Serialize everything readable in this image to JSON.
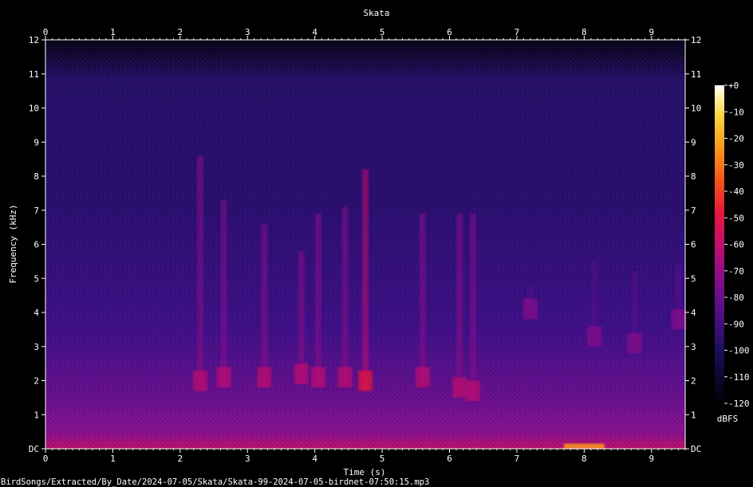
{
  "chart_data": {
    "type": "heatmap",
    "title": "Skata",
    "xlabel": "Time (s)",
    "ylabel": "Frequency (kHz)",
    "xlim": [
      0,
      9.5
    ],
    "ylim": [
      0,
      12
    ],
    "x_ticks": [
      "0",
      "1",
      "2",
      "3",
      "4",
      "5",
      "6",
      "7",
      "8",
      "9"
    ],
    "y_ticks": [
      "DC",
      "1",
      "2",
      "3",
      "4",
      "5",
      "6",
      "7",
      "8",
      "9",
      "10",
      "11",
      "12"
    ],
    "colorbar": {
      "label": "dBFS",
      "range": [
        -120,
        0
      ],
      "ticks": [
        "+0",
        "-10",
        "-20",
        "-30",
        "-40",
        "-50",
        "-60",
        "-70",
        "-80",
        "-90",
        "-100",
        "-110",
        "-120"
      ],
      "colors": [
        "#000000",
        "#0b0a3b",
        "#2a0f6b",
        "#5a0f8a",
        "#8a0f8a",
        "#c0106e",
        "#e8183a",
        "#f5541a",
        "#f8961c",
        "#fbd13a",
        "#fdf6b4",
        "#ffffff"
      ]
    },
    "calls": [
      {
        "t": 2.3,
        "f_low": 1.7,
        "f_high": 8.6,
        "level": -72
      },
      {
        "t": 2.65,
        "f_low": 1.8,
        "f_high": 7.3,
        "level": -76
      },
      {
        "t": 3.25,
        "f_low": 1.8,
        "f_high": 6.6,
        "level": -76
      },
      {
        "t": 3.8,
        "f_low": 1.9,
        "f_high": 5.8,
        "level": -78
      },
      {
        "t": 4.05,
        "f_low": 1.8,
        "f_high": 6.9,
        "level": -74
      },
      {
        "t": 4.45,
        "f_low": 1.8,
        "f_high": 7.1,
        "level": -73
      },
      {
        "t": 4.75,
        "f_low": 1.7,
        "f_high": 8.2,
        "level": -68
      },
      {
        "t": 5.6,
        "f_low": 1.8,
        "f_high": 6.9,
        "level": -74
      },
      {
        "t": 6.15,
        "f_low": 1.5,
        "f_high": 6.9,
        "level": -72
      },
      {
        "t": 6.35,
        "f_low": 1.4,
        "f_high": 6.9,
        "level": -74
      },
      {
        "t": 7.2,
        "f_low": 3.8,
        "f_high": 4.8,
        "level": -84
      },
      {
        "t": 8.15,
        "f_low": 3.0,
        "f_high": 5.5,
        "level": -88
      },
      {
        "t": 8.75,
        "f_low": 2.8,
        "f_high": 5.2,
        "level": -88
      },
      {
        "t": 9.4,
        "f_low": 3.5,
        "f_high": 5.4,
        "level": -86
      }
    ],
    "low_band_burst": {
      "t_start": 7.7,
      "t_end": 8.3,
      "f_high": 0.15,
      "level": -35
    }
  },
  "footer": {
    "file_path": "BirdSongs/Extracted/By_Date/2024-07-05/Skata/Skata-99-2024-07-05-birdnet-07:50:15.mp3"
  }
}
